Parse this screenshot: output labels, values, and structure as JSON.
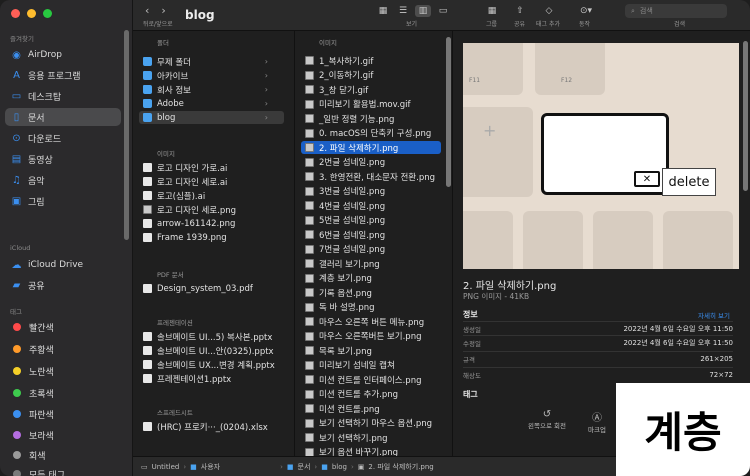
{
  "window": {
    "title": "blog"
  },
  "toolbar": {
    "back_forward_label": "뒤로/앞으로",
    "view_label": "보기",
    "group_label": "그룹",
    "share_label": "공유",
    "tag_label": "태그 추가",
    "action_label": "동작",
    "search_label": "검색",
    "search_placeholder": "검색"
  },
  "sidebar": {
    "favorites_header": "즐겨찾기",
    "favorites": [
      {
        "label": "AirDrop",
        "icon": "airdrop-icon"
      },
      {
        "label": "응용 프로그램",
        "icon": "applications-icon"
      },
      {
        "label": "데스크탑",
        "icon": "desktop-icon"
      },
      {
        "label": "문서",
        "icon": "document-icon"
      },
      {
        "label": "다운로드",
        "icon": "download-icon"
      },
      {
        "label": "동영상",
        "icon": "movie-icon"
      },
      {
        "label": "음악",
        "icon": "music-icon"
      },
      {
        "label": "그림",
        "icon": "photo-icon"
      }
    ],
    "icloud_header": "iCloud",
    "icloud": [
      {
        "label": "iCloud Drive",
        "icon": "cloud-icon"
      },
      {
        "label": "공유",
        "icon": "shared-folder-icon"
      }
    ],
    "tags_header": "태그",
    "tags": [
      {
        "label": "빨간색",
        "color": "#ff4a4a"
      },
      {
        "label": "주황색",
        "color": "#ff9a2a"
      },
      {
        "label": "노란색",
        "color": "#f5d028"
      },
      {
        "label": "초록색",
        "color": "#3ecb4e"
      },
      {
        "label": "파란색",
        "color": "#3b8ff0"
      },
      {
        "label": "보라색",
        "color": "#b46de0"
      },
      {
        "label": "회색",
        "color": "#9a9a9a"
      },
      {
        "label": "모든 태그",
        "color": "#7a7a7a"
      }
    ]
  },
  "column1": {
    "folders_header": "폴더",
    "folders": [
      "무제 폴더",
      "아카이브",
      "회사 정보",
      "Adobe",
      "blog"
    ],
    "images_header": "이미지",
    "images": [
      "로고 디자인 가로.ai",
      "로고 디자인 세로.ai",
      "로고(심플).ai",
      "로고 디자인 세로.png",
      "arrow-161142.png",
      "Frame 1939.png"
    ],
    "pdf_header": "PDF 문서",
    "pdfs": [
      "Design_system_03.pdf"
    ],
    "presentation_header": "프레젠테이션",
    "presentations": [
      "솔브메이트 UI...5) 복사본.pptx",
      "솔브메이트 UI...안(0325).pptx",
      "솔브메이트 UX...변경 계획.pptx",
      "프레젠테이션1.pptx"
    ],
    "spreadsheet_header": "스프레드시트",
    "spreadsheets": [
      "(HRC) 프로키···_(0204).xlsx"
    ]
  },
  "column2": {
    "header": "이미지",
    "files": [
      "1_복사하기.gif",
      "2_이동하기.gif",
      "3_창 닫기.gif",
      "미리보기 활용법.mov.gif",
      "_일반 정렬 기능.png",
      "0. macOS의 단축키 구성.png",
      "2. 파일 삭제하기.png",
      "2번글 섬네일.png",
      "3. 한영전환, 대소문자 전환.png",
      "3번글 섬네일.png",
      "4번글 섬네일.png",
      "5번글 섬네일.png",
      "6번글 섬네일.png",
      "7번글 섬네일.png",
      "갤러리 보기.png",
      "계층 보기.png",
      "기록 옵션.png",
      "독 바 설명.png",
      "마우스 오른쪽 버튼 메뉴.png",
      "마우스 오른쪽버튼 보기.png",
      "목록 보기.png",
      "미리보기 섬네일 캡쳐",
      "미션 컨트롤 인터페이스.png",
      "미션 컨트롤 추가.png",
      "미션 컨트롤.png",
      "보기 선택하기 마우스 옵션.png",
      "보기 선택하기.png",
      "보기 옵션 바꾸기.png"
    ],
    "selected_index": 6
  },
  "preview": {
    "image_label": "delete",
    "key_labels": {
      "f11": "F11",
      "f12": "F12"
    },
    "title": "2. 파일 삭제하기.png",
    "subtitle": "PNG 이미지 - 41KB",
    "info_header": "정보",
    "more_link": "자세히 보기",
    "info": [
      {
        "label": "생성일",
        "value": "2022년 4월 6일 수요일 오후 11:50"
      },
      {
        "label": "수정일",
        "value": "2022년 4월 6일 수요일 오후 11:50"
      },
      {
        "label": "규격",
        "value": "261×205"
      },
      {
        "label": "해상도",
        "value": "72×72"
      }
    ],
    "tags_header": "태그",
    "actions": [
      {
        "label": "왼쪽으로 회전"
      },
      {
        "label": "마크업"
      }
    ]
  },
  "overlay_text": "계층",
  "pathbar": [
    "Untitled",
    "사용자",
    "문서",
    "blog",
    "2. 파일 삭제하기.png"
  ]
}
